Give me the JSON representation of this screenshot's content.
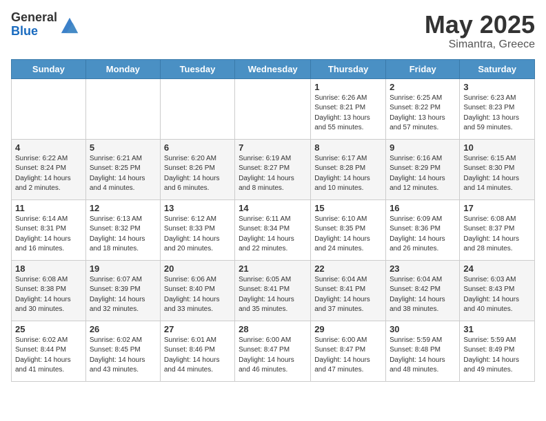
{
  "header": {
    "logo_general": "General",
    "logo_blue": "Blue",
    "month_title": "May 2025",
    "subtitle": "Simantra, Greece"
  },
  "days_of_week": [
    "Sunday",
    "Monday",
    "Tuesday",
    "Wednesday",
    "Thursday",
    "Friday",
    "Saturday"
  ],
  "weeks": [
    [
      {
        "day": "",
        "info": ""
      },
      {
        "day": "",
        "info": ""
      },
      {
        "day": "",
        "info": ""
      },
      {
        "day": "",
        "info": ""
      },
      {
        "day": "1",
        "info": "Sunrise: 6:26 AM\nSunset: 8:21 PM\nDaylight: 13 hours and 55 minutes."
      },
      {
        "day": "2",
        "info": "Sunrise: 6:25 AM\nSunset: 8:22 PM\nDaylight: 13 hours and 57 minutes."
      },
      {
        "day": "3",
        "info": "Sunrise: 6:23 AM\nSunset: 8:23 PM\nDaylight: 13 hours and 59 minutes."
      }
    ],
    [
      {
        "day": "4",
        "info": "Sunrise: 6:22 AM\nSunset: 8:24 PM\nDaylight: 14 hours and 2 minutes."
      },
      {
        "day": "5",
        "info": "Sunrise: 6:21 AM\nSunset: 8:25 PM\nDaylight: 14 hours and 4 minutes."
      },
      {
        "day": "6",
        "info": "Sunrise: 6:20 AM\nSunset: 8:26 PM\nDaylight: 14 hours and 6 minutes."
      },
      {
        "day": "7",
        "info": "Sunrise: 6:19 AM\nSunset: 8:27 PM\nDaylight: 14 hours and 8 minutes."
      },
      {
        "day": "8",
        "info": "Sunrise: 6:17 AM\nSunset: 8:28 PM\nDaylight: 14 hours and 10 minutes."
      },
      {
        "day": "9",
        "info": "Sunrise: 6:16 AM\nSunset: 8:29 PM\nDaylight: 14 hours and 12 minutes."
      },
      {
        "day": "10",
        "info": "Sunrise: 6:15 AM\nSunset: 8:30 PM\nDaylight: 14 hours and 14 minutes."
      }
    ],
    [
      {
        "day": "11",
        "info": "Sunrise: 6:14 AM\nSunset: 8:31 PM\nDaylight: 14 hours and 16 minutes."
      },
      {
        "day": "12",
        "info": "Sunrise: 6:13 AM\nSunset: 8:32 PM\nDaylight: 14 hours and 18 minutes."
      },
      {
        "day": "13",
        "info": "Sunrise: 6:12 AM\nSunset: 8:33 PM\nDaylight: 14 hours and 20 minutes."
      },
      {
        "day": "14",
        "info": "Sunrise: 6:11 AM\nSunset: 8:34 PM\nDaylight: 14 hours and 22 minutes."
      },
      {
        "day": "15",
        "info": "Sunrise: 6:10 AM\nSunset: 8:35 PM\nDaylight: 14 hours and 24 minutes."
      },
      {
        "day": "16",
        "info": "Sunrise: 6:09 AM\nSunset: 8:36 PM\nDaylight: 14 hours and 26 minutes."
      },
      {
        "day": "17",
        "info": "Sunrise: 6:08 AM\nSunset: 8:37 PM\nDaylight: 14 hours and 28 minutes."
      }
    ],
    [
      {
        "day": "18",
        "info": "Sunrise: 6:08 AM\nSunset: 8:38 PM\nDaylight: 14 hours and 30 minutes."
      },
      {
        "day": "19",
        "info": "Sunrise: 6:07 AM\nSunset: 8:39 PM\nDaylight: 14 hours and 32 minutes."
      },
      {
        "day": "20",
        "info": "Sunrise: 6:06 AM\nSunset: 8:40 PM\nDaylight: 14 hours and 33 minutes."
      },
      {
        "day": "21",
        "info": "Sunrise: 6:05 AM\nSunset: 8:41 PM\nDaylight: 14 hours and 35 minutes."
      },
      {
        "day": "22",
        "info": "Sunrise: 6:04 AM\nSunset: 8:41 PM\nDaylight: 14 hours and 37 minutes."
      },
      {
        "day": "23",
        "info": "Sunrise: 6:04 AM\nSunset: 8:42 PM\nDaylight: 14 hours and 38 minutes."
      },
      {
        "day": "24",
        "info": "Sunrise: 6:03 AM\nSunset: 8:43 PM\nDaylight: 14 hours and 40 minutes."
      }
    ],
    [
      {
        "day": "25",
        "info": "Sunrise: 6:02 AM\nSunset: 8:44 PM\nDaylight: 14 hours and 41 minutes."
      },
      {
        "day": "26",
        "info": "Sunrise: 6:02 AM\nSunset: 8:45 PM\nDaylight: 14 hours and 43 minutes."
      },
      {
        "day": "27",
        "info": "Sunrise: 6:01 AM\nSunset: 8:46 PM\nDaylight: 14 hours and 44 minutes."
      },
      {
        "day": "28",
        "info": "Sunrise: 6:00 AM\nSunset: 8:47 PM\nDaylight: 14 hours and 46 minutes."
      },
      {
        "day": "29",
        "info": "Sunrise: 6:00 AM\nSunset: 8:47 PM\nDaylight: 14 hours and 47 minutes."
      },
      {
        "day": "30",
        "info": "Sunrise: 5:59 AM\nSunset: 8:48 PM\nDaylight: 14 hours and 48 minutes."
      },
      {
        "day": "31",
        "info": "Sunrise: 5:59 AM\nSunset: 8:49 PM\nDaylight: 14 hours and 49 minutes."
      }
    ]
  ]
}
